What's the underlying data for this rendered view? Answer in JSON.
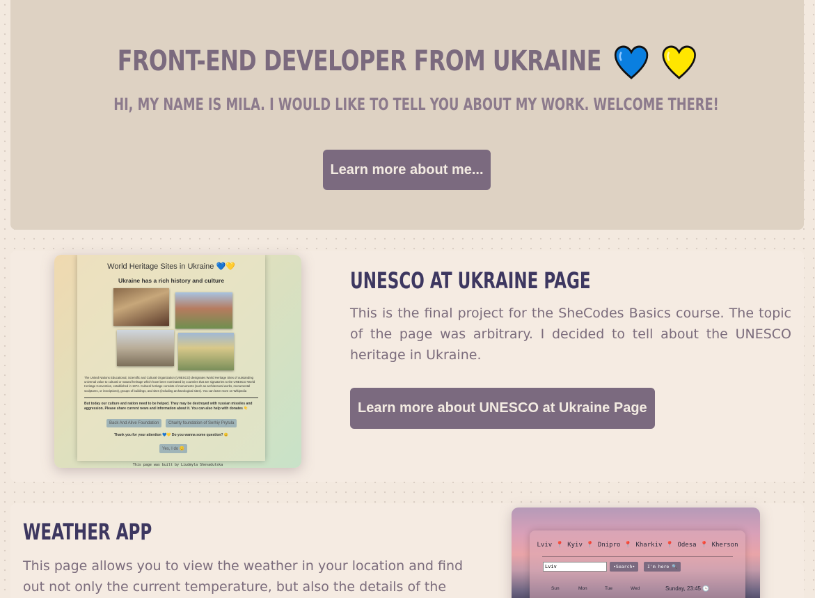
{
  "hero": {
    "title": "Front-end developer from Ukraine",
    "subtitle": "Hi, my name is Mila. I would like to tell you about my work. Welcome there!",
    "button_label": "Learn more about me...",
    "heart_colors": [
      "#0a7fe0",
      "#ffe600"
    ]
  },
  "projects": [
    {
      "title": "UNESCO at Ukraine Page",
      "description": "This is the final project for the SheCodes Basics course. The topic of the page was arbitrary. I decided to tell about the UNESCO heritage in Ukraine.",
      "button_label": "Learn more about UNESCO at Ukraine Page",
      "preview": {
        "title": "World Heritage Sites in Ukraine 💙💛",
        "subtitle": "Ukraine has a rich history and culture",
        "text1": "The United Nations Educational, Scientific and Cultural Organization (UNESCO) designates World Heritage Sites of outstanding universal value to cultural or natural heritage which have been nominated by countries that are signatories to the UNESCO World Heritage Convention, established in 1972. Cultural heritage consists of monuments (such as architectural works, monumental sculptures, or inscriptions), groups of buildings, and sites (including archaeological sites). You can learn more on Wikipedia",
        "text2": "But today our culture and nation need to be helped. They may be destroyed with russian missiles and aggression. Please share current news and information about it. You can also help with donates 👇",
        "btn1": "Back And Alive Foundation",
        "btn2": "Charity foundation of Serhiy Prytula",
        "thanks": "Thank you for your attention 💙💛 Do you wanna some question? 😊",
        "btn3": "Yes, I do 😊",
        "footer": "This page was built by Liudmyla Shevadutska"
      }
    },
    {
      "title": "Weather App",
      "description": "This page allows you to view the weather in your location and find out not only the current temperature, but also the details of the weather at",
      "preview": {
        "cities": "Lviv 📍 Kyiv 📍 Dnipro 📍 Kharkiv 📍 Odesa 📍 Kherson",
        "input_value": "Lviv",
        "search_label": "•Search•",
        "here_label": "I'm here 🔍",
        "days": [
          "Sun",
          "Mon",
          "Tue",
          "Wed"
        ],
        "date": "Sunday, 23:45 🕓"
      }
    }
  ]
}
